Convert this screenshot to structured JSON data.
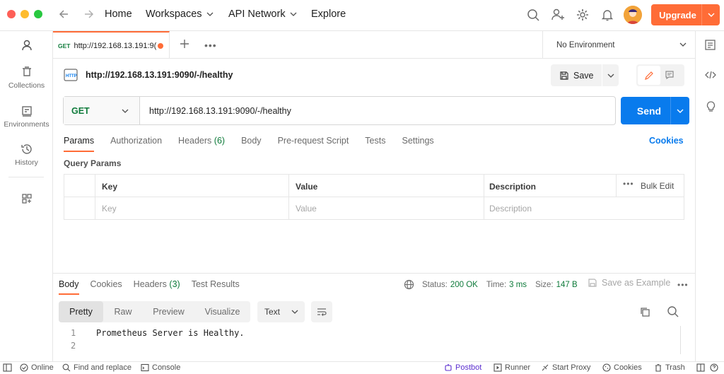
{
  "window": {
    "traffic_light_colors": [
      "#fe5f57",
      "#febc2e",
      "#28c840"
    ]
  },
  "nav": {
    "home": "Home",
    "workspaces": "Workspaces",
    "api_network": "API Network",
    "explore": "Explore",
    "upgrade": "Upgrade"
  },
  "sidebar": {
    "items": [
      {
        "label": "",
        "icon": "user-icon"
      },
      {
        "label": "Collections",
        "icon": "trash-can-icon"
      },
      {
        "label": "Environments",
        "icon": "environment-icon"
      },
      {
        "label": "History",
        "icon": "history-icon"
      },
      {
        "label": "",
        "icon": "apps-grid-icon"
      }
    ]
  },
  "tab": {
    "method": "GET",
    "title": "http://192.168.13.191:9("
  },
  "environment": {
    "selected": "No Environment"
  },
  "request": {
    "title": "http://192.168.13.191:9090/-/healthy",
    "save_label": "Save",
    "method": "GET",
    "url": "http://192.168.13.191:9090/-/healthy",
    "send_label": "Send"
  },
  "request_tabs": {
    "params": "Params",
    "authorization": "Authorization",
    "headers": "Headers",
    "headers_count": "(6)",
    "body": "Body",
    "prerequest": "Pre-request Script",
    "tests": "Tests",
    "settings": "Settings",
    "cookies": "Cookies"
  },
  "params": {
    "section_title": "Query Params",
    "columns": [
      "Key",
      "Value",
      "Description"
    ],
    "bulk_edit": "Bulk Edit",
    "placeholders": [
      "Key",
      "Value",
      "Description"
    ]
  },
  "response": {
    "tabs": {
      "body": "Body",
      "cookies": "Cookies",
      "headers": "Headers",
      "headers_count": "(3)",
      "test_results": "Test Results"
    },
    "status_label": "Status:",
    "status_value": "200 OK",
    "time_label": "Time:",
    "time_value": "3 ms",
    "size_label": "Size:",
    "size_value": "147 B",
    "save_as_example": "Save as Example",
    "formats": [
      "Pretty",
      "Raw",
      "Preview",
      "Visualize"
    ],
    "text_type": "Text",
    "lines": [
      {
        "num": "1",
        "text": "Prometheus Server is Healthy."
      },
      {
        "num": "2",
        "text": ""
      }
    ]
  },
  "statusbar": {
    "online": "Online",
    "find_replace": "Find and replace",
    "console": "Console",
    "postbot": "Postbot",
    "runner": "Runner",
    "start_proxy": "Start Proxy",
    "cookies": "Cookies",
    "trash": "Trash"
  }
}
